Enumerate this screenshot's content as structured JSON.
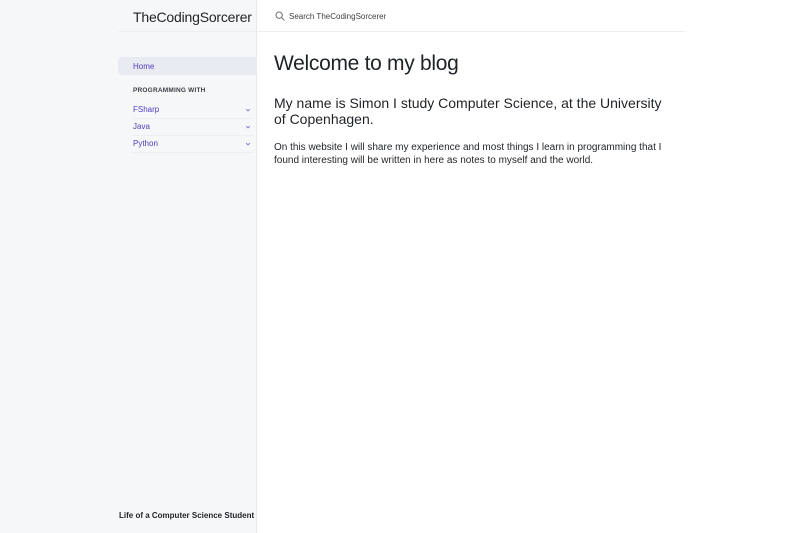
{
  "site": {
    "title": "TheCodingSorcerer"
  },
  "search": {
    "placeholder": "Search TheCodingSorcerer"
  },
  "sidebar": {
    "home_label": "Home",
    "section_heading": "PROGRAMMING WITH",
    "items": [
      {
        "label": "FSharp",
        "icon": "chevron-down-icon"
      },
      {
        "label": "Java",
        "icon": "chevron-down-icon"
      },
      {
        "label": "Python",
        "icon": "chevron-down-icon"
      }
    ],
    "footer": "Life of a Computer Science Student"
  },
  "main": {
    "title": "Welcome to my blog",
    "intro": "My name is Simon I study Computer Science, at the University of Copenhagen.",
    "paragraph": "On this website I will share my experience and most things I learn in programming that I found interesting will be written in here as notes to myself and the world."
  },
  "colors": {
    "accent": "#4a3fbf",
    "sidebar_bg": "#f6f7f9",
    "active_item_bg": "#e9ebf2"
  }
}
